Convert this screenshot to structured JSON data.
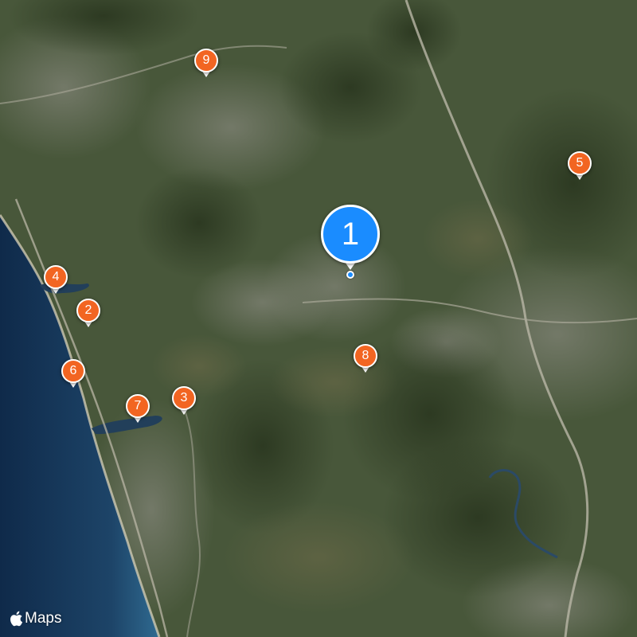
{
  "map": {
    "type": "satellite",
    "attribution": "Maps",
    "colors": {
      "primary_pin": "#1a8cff",
      "secondary_pin": "#f26522",
      "pin_border": "#ffffff",
      "ocean_deep": "#0f2a4a",
      "ocean_shore": "#2c5f86",
      "land": "#4a5a38"
    },
    "pins": [
      {
        "label": "1",
        "selected": true
      },
      {
        "label": "2",
        "selected": false
      },
      {
        "label": "3",
        "selected": false
      },
      {
        "label": "4",
        "selected": false
      },
      {
        "label": "5",
        "selected": false
      },
      {
        "label": "6",
        "selected": false
      },
      {
        "label": "7",
        "selected": false
      },
      {
        "label": "8",
        "selected": false
      },
      {
        "label": "9",
        "selected": false
      }
    ]
  }
}
